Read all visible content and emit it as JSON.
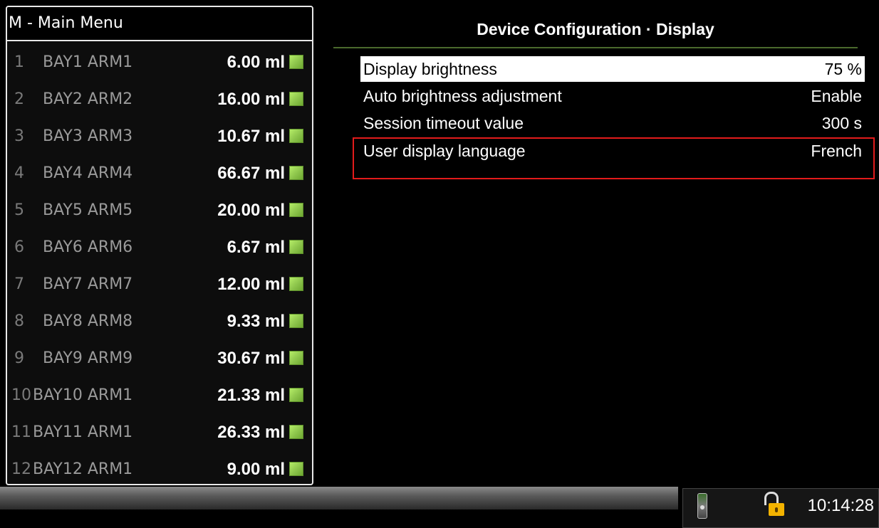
{
  "sidebar": {
    "title": "M - Main Menu",
    "items": [
      {
        "num": "1",
        "name": "BAY1 ARM1",
        "volume": "6.00 ml"
      },
      {
        "num": "2",
        "name": "BAY2 ARM2",
        "volume": "16.00 ml"
      },
      {
        "num": "3",
        "name": "BAY3 ARM3",
        "volume": "10.67 ml"
      },
      {
        "num": "4",
        "name": "BAY4 ARM4",
        "volume": "66.67 ml"
      },
      {
        "num": "5",
        "name": "BAY5 ARM5",
        "volume": "20.00 ml"
      },
      {
        "num": "6",
        "name": "BAY6 ARM6",
        "volume": "6.67 ml"
      },
      {
        "num": "7",
        "name": "BAY7 ARM7",
        "volume": "12.00 ml"
      },
      {
        "num": "8",
        "name": "BAY8 ARM8",
        "volume": "9.33 ml"
      },
      {
        "num": "9",
        "name": "BAY9 ARM9",
        "volume": "30.67 ml"
      },
      {
        "num": "10",
        "name": "BAY10 ARM1",
        "volume": "21.33 ml"
      },
      {
        "num": "11",
        "name": "BAY11 ARM1",
        "volume": "26.33 ml"
      },
      {
        "num": "12",
        "name": "BAY12 ARM1",
        "volume": "9.00 ml"
      }
    ],
    "status_led_color": "#8bc34a"
  },
  "page": {
    "title": "Device Configuration · Display"
  },
  "settings": [
    {
      "label": "Display brightness",
      "value": "75 %"
    },
    {
      "label": "Auto brightness adjustment",
      "value": "Enable"
    },
    {
      "label": "Session timeout value",
      "value": "300 s"
    },
    {
      "label": "User display language",
      "value": "French"
    }
  ],
  "selection": {
    "selected_row_color": "#ffffff",
    "highlight_color": "#e21b1b"
  },
  "statusbar": {
    "remote_icon": "remote-control-icon",
    "lock_icon": "unlocked-padlock-icon",
    "time": "10:14:28"
  }
}
